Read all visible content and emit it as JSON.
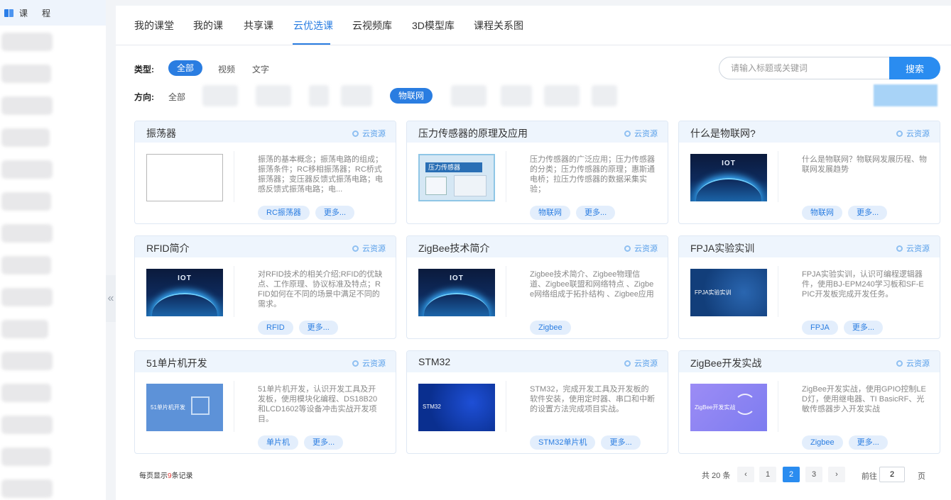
{
  "sidebar": {
    "title": "课程",
    "icon": "book-icon"
  },
  "tabs": [
    {
      "label": "我的课堂"
    },
    {
      "label": "我的课"
    },
    {
      "label": "共享课"
    },
    {
      "label": "云优选课"
    },
    {
      "label": "云视频库"
    },
    {
      "label": "3D模型库"
    },
    {
      "label": "课程关系图"
    }
  ],
  "active_tab": "云优选课",
  "filters": {
    "type_label": "类型:",
    "type_options": [
      "全部",
      "视频",
      "文字"
    ],
    "type_selected": "全部",
    "direction_label": "方向:",
    "direction_all": "全部",
    "direction_selected": "物联网"
  },
  "search": {
    "placeholder": "请输入标题或关键词",
    "button": "搜索"
  },
  "cloud_label": "云资源",
  "cards": [
    {
      "title": "振荡器",
      "desc": "振荡的基本概念；振荡电路的组成；振荡条件；RC移相振荡器；RC桥式振荡器；变压器反馈式振荡电路；电感反馈式振荡电路；电...",
      "tag": "RC振荡器",
      "more": "更多..."
    },
    {
      "title": "压力传感器的原理及应用",
      "desc": "压力传感器的广泛应用；压力传感器的分类；压力传感器的原理；惠斯通电桥；拉压力传感器的数据采集实验；",
      "tag": "物联网",
      "more": "更多...",
      "thumb_text": "压力传感器"
    },
    {
      "title": "什么是物联网?",
      "desc": "什么是物联网？物联网发展历程、物联网发展趋势",
      "tag": "物联网",
      "more": "更多...",
      "thumb_text": "IOT"
    },
    {
      "title": "RFID简介",
      "desc": "对RFID技术的相关介绍;RFID的优缺点、工作原理、协议标准及特点；RFID如何在不同的场景中满足不同的需求。",
      "tag": "RFID",
      "more": "更多...",
      "thumb_text": "IOT"
    },
    {
      "title": "ZigBee技术简介",
      "desc": "Zigbee技术简介、Zigbee物理信道、Zigbee联盟和网络特点 、Zigbee网络组成于拓扑结构 、Zigbee应用",
      "tag": "Zigbee",
      "more": "",
      "thumb_text": "IOT"
    },
    {
      "title": "FPJA实验实训",
      "desc": "FPJA实验实训，认识可编程逻辑器件，使用BJ-EPM240学习板和SF-EPIC开发板完成开发任务。",
      "tag": "FPJA",
      "more": "更多...",
      "thumb_text": "FPJA实验实训"
    },
    {
      "title": "51单片机开发",
      "desc": "51单片机开发，认识开发工具及开发板，使用模块化编程、DS18B20和LCD1602等设备冲击实战开发项目。",
      "tag": "单片机",
      "more": "更多...",
      "thumb_text": "51单片机开发"
    },
    {
      "title": "STM32",
      "desc": "STM32，完成开发工具及开发板的软件安装，使用定时器、串口和中断的设置方法完成项目实战。",
      "tag": "STM32单片机",
      "more": "更多...",
      "thumb_text": "STM32"
    },
    {
      "title": "ZigBee开发实战",
      "desc": "ZigBee开发实战，使用GPIO控制LED灯，使用继电器、TI BasicRF、光敏传感器步入开发实战",
      "tag": "Zigbee",
      "more": "更多...",
      "thumb_text": "ZigBee开发实战"
    }
  ],
  "pagination": {
    "per_page_prefix": "每页显示",
    "per_page_count": "9",
    "per_page_suffix": "条记录",
    "total": "共 20 条",
    "prev": "‹",
    "pages": [
      "1",
      "2",
      "3"
    ],
    "current": "2",
    "next": "›",
    "goto_label": "前往",
    "goto_value": "2",
    "goto_unit": "页"
  }
}
